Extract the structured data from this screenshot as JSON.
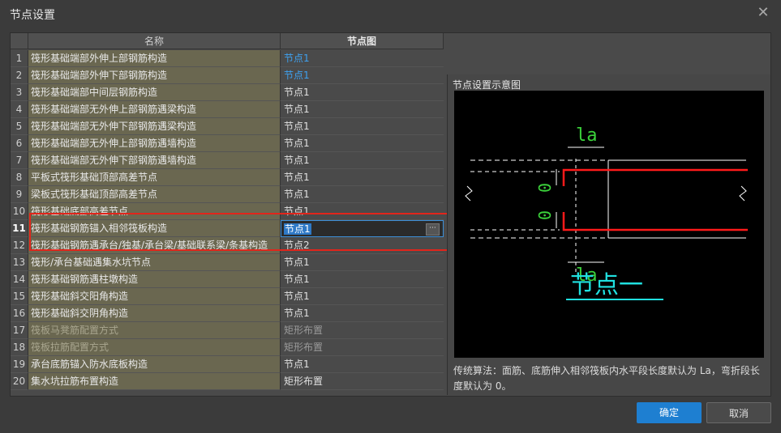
{
  "window": {
    "title": "节点设置",
    "close_icon": "close-icon"
  },
  "table": {
    "headers": {
      "num": "",
      "name": "名称",
      "node": "节点图"
    },
    "rows": [
      {
        "num": "1",
        "name": "筏形基础端部外伸上部钢筋构造",
        "node": "节点1",
        "state": "blue"
      },
      {
        "num": "2",
        "name": "筏形基础端部外伸下部钢筋构造",
        "node": "节点1",
        "state": "blue"
      },
      {
        "num": "3",
        "name": "筏形基础端部中间层钢筋构造",
        "node": "节点1",
        "state": ""
      },
      {
        "num": "4",
        "name": "筏形基础端部无外伸上部钢筋遇梁构造",
        "node": "节点1",
        "state": ""
      },
      {
        "num": "5",
        "name": "筏形基础端部无外伸下部钢筋遇梁构造",
        "node": "节点1",
        "state": ""
      },
      {
        "num": "6",
        "name": "筏形基础端部无外伸上部钢筋遇墙构造",
        "node": "节点1",
        "state": ""
      },
      {
        "num": "7",
        "name": "筏形基础端部无外伸下部钢筋遇墙构造",
        "node": "节点1",
        "state": ""
      },
      {
        "num": "8",
        "name": "平板式筏形基础顶部高差节点",
        "node": "节点1",
        "state": ""
      },
      {
        "num": "9",
        "name": "梁板式筏形基础顶部高差节点",
        "node": "节点1",
        "state": ""
      },
      {
        "num": "10",
        "name": "筏形基础底部高差节点",
        "node": "节点1",
        "state": ""
      },
      {
        "num": "11",
        "name": "筏形基础钢筋锚入相邻筏板构造",
        "node": "节点1",
        "state": "sel"
      },
      {
        "num": "12",
        "name": "筏形基础钢筋遇承台/独基/承台梁/基础联系梁/条基构造",
        "node": "节点2",
        "state": ""
      },
      {
        "num": "13",
        "name": "筏形/承台基础遇集水坑节点",
        "node": "节点1",
        "state": ""
      },
      {
        "num": "14",
        "name": "筏形基础钢筋遇柱墩构造",
        "node": "节点1",
        "state": ""
      },
      {
        "num": "15",
        "name": "筏形基础斜交阳角构造",
        "node": "节点1",
        "state": ""
      },
      {
        "num": "16",
        "name": "筏形基础斜交阴角构造",
        "node": "节点1",
        "state": ""
      },
      {
        "num": "17",
        "name": "筏板马凳筋配置方式",
        "node": "矩形布置",
        "state": "dim"
      },
      {
        "num": "18",
        "name": "筏板拉筋配置方式",
        "node": "矩形布置",
        "state": "dim"
      },
      {
        "num": "19",
        "name": "承台底筋锚入防水底板构造",
        "node": "节点1",
        "state": ""
      },
      {
        "num": "20",
        "name": "集水坑拉筋布置构造",
        "node": "矩形布置",
        "state": ""
      }
    ],
    "ellipsis": "···"
  },
  "preview": {
    "title": "节点设置示意图",
    "diagram": {
      "top_label": "la",
      "bottom_label": "la",
      "zero_top": "0",
      "zero_bottom": "0",
      "caption": "节点一"
    },
    "description": "传统算法：面筋、底筋伸入相邻筏板内水平段长度默认为 La，弯折段长度默认为 0。"
  },
  "buttons": {
    "ok": "确定",
    "cancel": "取消"
  },
  "colors": {
    "accent": "#1e7fd1",
    "highlight": "#e1251b",
    "name_cell": "#6a6750",
    "link": "#3ea1f0"
  }
}
